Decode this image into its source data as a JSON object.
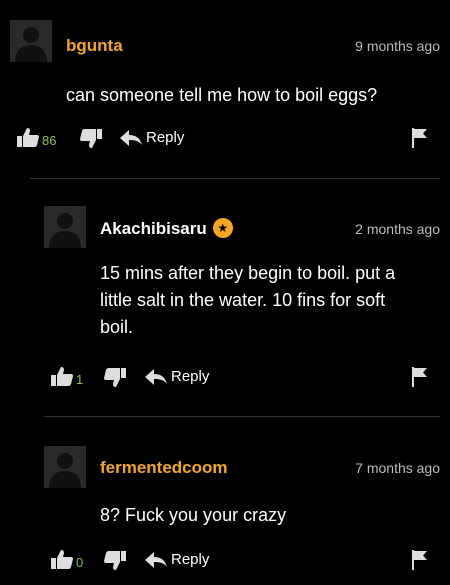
{
  "comments": [
    {
      "username": "bgunta",
      "time": "9 months ago",
      "text": "can someone tell me how to boil eggs?",
      "likes": "86",
      "reply_label": "Reply"
    },
    {
      "username": "Akachibisaru",
      "badge": "★",
      "time": "2 months ago",
      "text": "15 mins after they begin to boil. put a little salt in the water. 10 fins for soft boil.",
      "likes": "1",
      "reply_label": "Reply"
    },
    {
      "username": "fermentedcoom",
      "time": "7 months ago",
      "text": "8? Fuck you your crazy",
      "likes": "0",
      "reply_label": "Reply"
    }
  ],
  "icons": {
    "avatar": "user-silhouette-icon",
    "like": "thumbs-up-icon",
    "dislike": "thumbs-down-icon",
    "reply": "reply-arrow-icon",
    "flag": "flag-icon",
    "badge": "star-badge-icon"
  },
  "colors": {
    "background": "#000000",
    "accent": "#f5a623",
    "like_count": "#8cc34a"
  }
}
